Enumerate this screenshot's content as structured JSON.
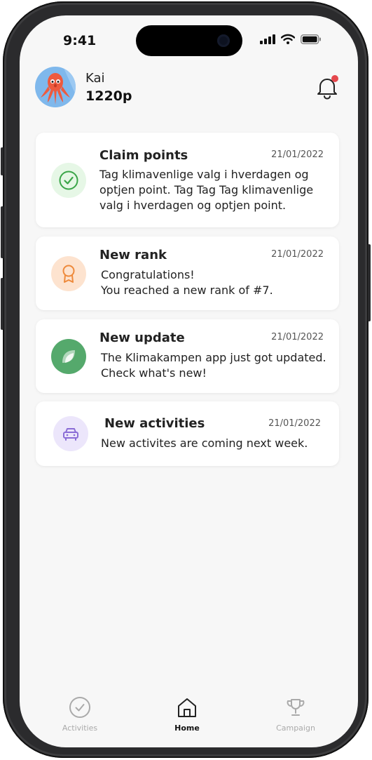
{
  "status_bar": {
    "time": "9:41"
  },
  "user": {
    "name": "Kai",
    "points": "1220p"
  },
  "notifications": [
    {
      "title": "Claim points",
      "date": "21/01/2022",
      "text": "Tag klimavenlige valg i hverdagen og optjen point. Tag Tag Tag klimavenlige valg i hverdagen og optjen point.",
      "icon": "check-circle-icon",
      "icon_bg": "#e6f7e6",
      "icon_color": "#3aa548"
    },
    {
      "title": "New rank",
      "date": "21/01/2022",
      "text": "Congratulations!\nYou reached a new rank of #7.",
      "icon": "award-ribbon-icon",
      "icon_bg": "#fde3cf",
      "icon_color": "#ee8a3c"
    },
    {
      "title": "New update",
      "date": "21/01/2022",
      "text": "The Klimakampen app just got updated. Check what's new!",
      "icon": "leaf-icon",
      "icon_bg": "#55a96c",
      "icon_color": "#ffffff"
    },
    {
      "title": "New activities",
      "date": "21/01/2022",
      "text": "New activites are coming next week.",
      "icon": "car-icon",
      "icon_bg": "#ece6fb",
      "icon_color": "#8b6dd6"
    }
  ],
  "tabs": [
    {
      "label": "Activities",
      "icon": "check-circle-icon",
      "active": false
    },
    {
      "label": "Home",
      "icon": "home-icon",
      "active": true
    },
    {
      "label": "Campaign",
      "icon": "trophy-icon",
      "active": false
    }
  ],
  "colors": {
    "notification_dot": "#e5484d",
    "background": "#f7f7f7"
  }
}
